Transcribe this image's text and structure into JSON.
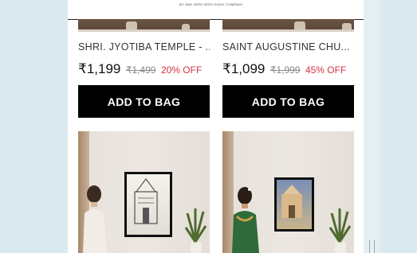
{
  "header": {
    "tagline": "BY ONE ZERO ZERO EIGHT COMPANY"
  },
  "products": [
    {
      "title": "SHRI. JYOTIBA TEMPLE - ...",
      "price": "₹1,199",
      "mrp": "₹1,499",
      "discount": "20% OFF",
      "button_label": "ADD TO BAG"
    },
    {
      "title": "SAINT AUGUSTINE CHU...",
      "price": "₹1,099",
      "mrp": "₹1,999",
      "discount": "45% OFF",
      "button_label": "ADD TO BAG"
    }
  ],
  "colors": {
    "accent_discount": "#d4333f",
    "button_bg": "#000000",
    "page_bg": "#dbeaee"
  }
}
